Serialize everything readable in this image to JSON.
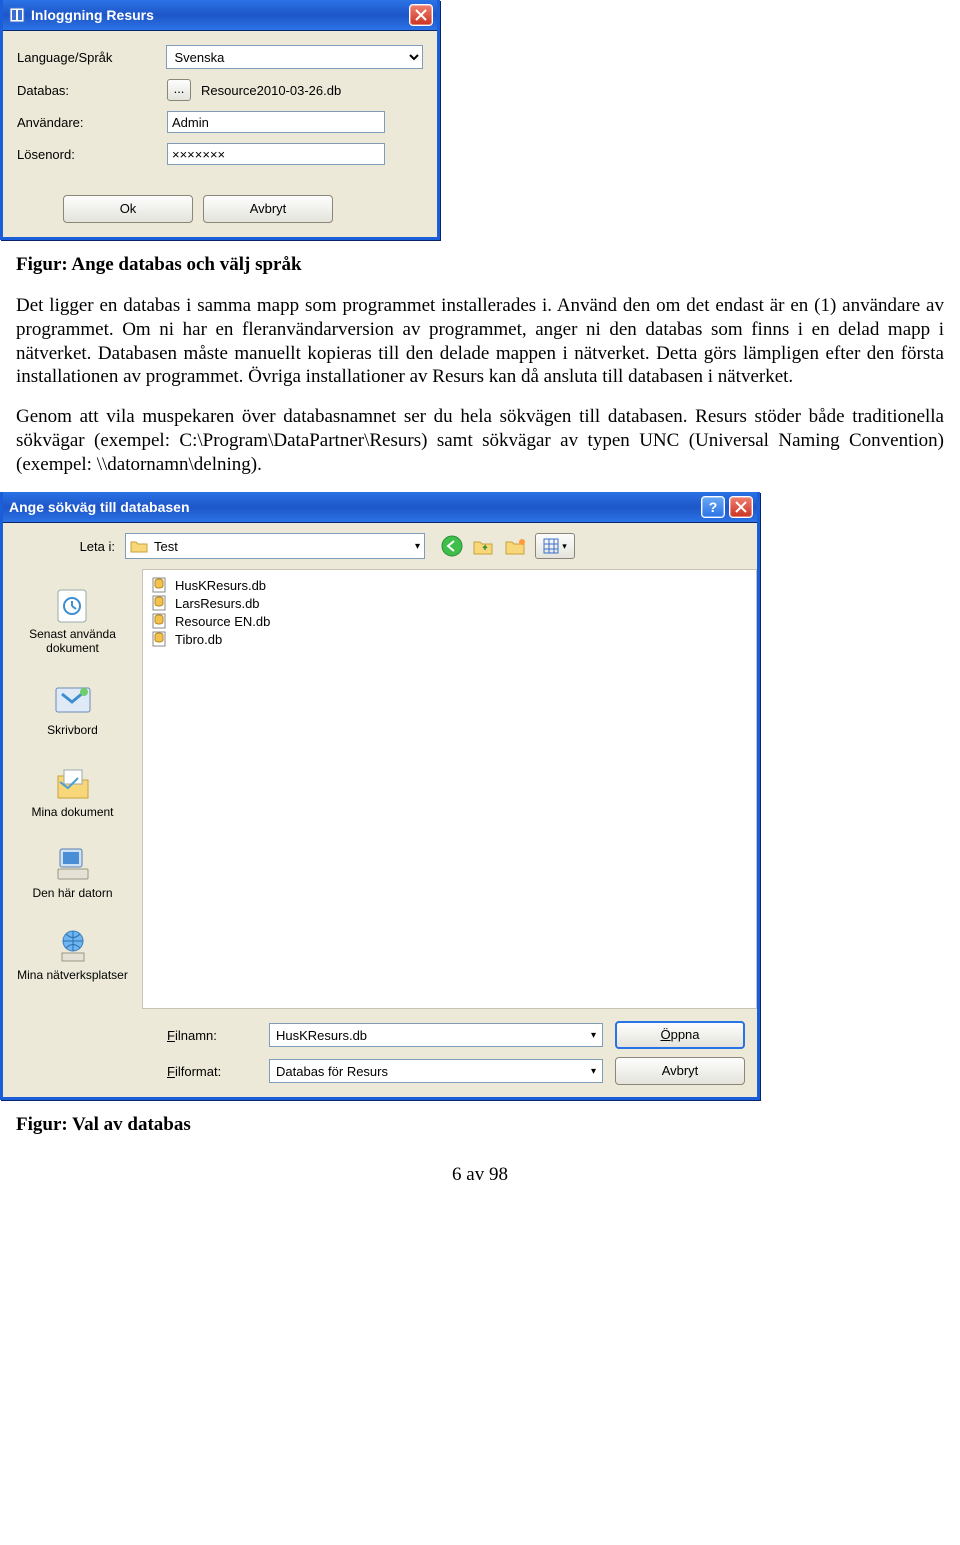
{
  "login_dialog": {
    "title": "Inloggning Resurs",
    "labels": {
      "language": "Language/Språk",
      "database": "Databas:",
      "user": "Användare:",
      "password": "Lösenord:"
    },
    "values": {
      "language": "Svenska",
      "database": "Resource2010-03-26.db",
      "user": "Admin",
      "password": "×××××××"
    },
    "buttons": {
      "ok": "Ok",
      "cancel": "Avbryt",
      "browse": "..."
    }
  },
  "caption1": "Figur: Ange databas och välj språk",
  "paragraph1": "Det ligger en databas i samma mapp som programmet installerades i. Använd den om det endast är en (1) användare av programmet. Om ni har en fleranvändarversion av programmet, anger ni den databas som finns i en delad mapp i nätverket. Databasen måste manuellt kopieras till den delade mappen i nätverket. Detta görs lämpligen efter den första installationen av programmet. Övriga installationer av Resurs kan då ansluta till databasen i nätverket.",
  "paragraph2": "Genom att vila muspekaren över databasnamnet ser du hela sökvägen till databasen. Resurs stöder både traditionella sökvägar (exempel: C:\\Program\\DataPartner\\Resurs) samt sökvägar av typen UNC (Universal Naming Convention) (exempel: \\\\datornamn\\delning).",
  "open_dialog": {
    "title": "Ange sökväg till databasen",
    "look_in_label": "Leta i:",
    "look_in_value": "Test",
    "places": [
      {
        "key": "recent",
        "label": "Senast använda dokument"
      },
      {
        "key": "desktop",
        "label": "Skrivbord"
      },
      {
        "key": "mydocs",
        "label": "Mina dokument"
      },
      {
        "key": "mycomp",
        "label": "Den här datorn"
      },
      {
        "key": "network",
        "label": "Mina nätverksplatser"
      }
    ],
    "files": [
      "HusKResurs.db",
      "LarsResurs.db",
      "Resource EN.db",
      "Tibro.db"
    ],
    "filename_label": "Filnamn:",
    "filename_value": "HusKResurs.db",
    "filetype_label": "Filformat:",
    "filetype_value": "Databas för Resurs",
    "buttons": {
      "open": "Öppna",
      "cancel": "Avbryt"
    }
  },
  "caption2": "Figur: Val av databas",
  "page_number": "6 av 98"
}
